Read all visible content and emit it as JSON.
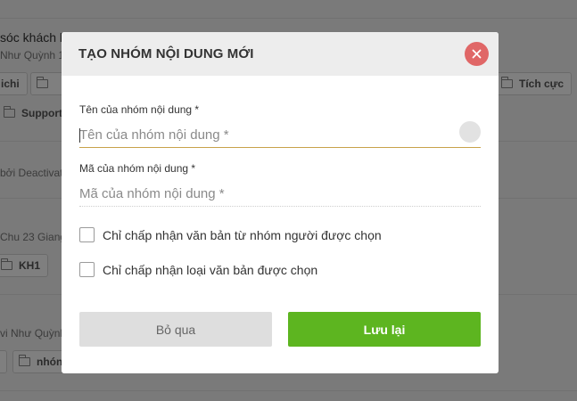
{
  "background": {
    "item1_title": "sóc khách h",
    "item1_sub": "Như Quỳnh 1",
    "chip_chichi": "ichi",
    "chip_support": "Support",
    "chip_tichcuc": "Tích cực",
    "item2_sub": "bởi Deactivat",
    "item3_sub": "Chu 23 Giang",
    "chip_kh1": "KH1",
    "item4_sub": "vi Như Quỳnh",
    "chip_nhom": "nhón"
  },
  "modal": {
    "title": "TẠO NHÓM NỘI DUNG MỚI",
    "close_icon": "close-icon",
    "name_label": "Tên của nhóm nội dung *",
    "name_placeholder": "Tên của nhóm nội dung *",
    "name_value": "",
    "code_label": "Mã của nhóm nội dung *",
    "code_placeholder": "Mã của nhóm nội dung *",
    "code_value": "",
    "check_groups_label": "Chỉ chấp nhận văn bản từ nhóm người được chọn",
    "check_groups_checked": false,
    "check_types_label": "Chỉ chấp nhận loại văn bản được chọn",
    "check_types_checked": false,
    "cancel_label": "Bỏ qua",
    "save_label": "Lưu lại"
  },
  "colors": {
    "save_button": "#5db520",
    "close_button": "#e06767",
    "active_underline": "#c8a24a",
    "header_bg": "#ededed"
  }
}
